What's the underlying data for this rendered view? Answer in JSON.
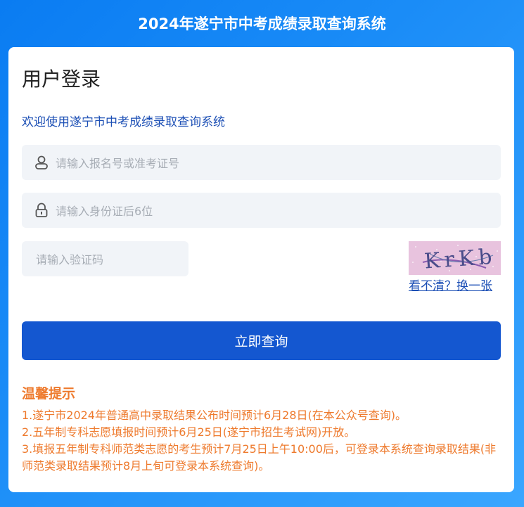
{
  "header": {
    "title": "2024年遂宁市中考成绩录取查询系统"
  },
  "login": {
    "title": "用户登录",
    "welcome": "欢迎使用遂宁市中考成绩录取查询系统",
    "username_placeholder": "请输入报名号或准考证号",
    "id_placeholder": "请输入身份证后6位",
    "captcha_placeholder": "请输入验证码",
    "captcha_text": "KrKb",
    "refresh_label": "看不清？换一张",
    "submit_label": "立即查询"
  },
  "tips": {
    "title": "温馨提示",
    "items": [
      "1.遂宁市2024年普通高中录取结果公布时间预计6月28日(在本公众号查询)。",
      "2.五年制专科志愿填报时间预计6月25日(遂宁市招生考试网)开放。",
      "3.填报五年制专科师范类志愿的考生预计7月25日上午10:00后，可登录本系统查询录取结果(非师范类录取结果预计8月上旬可登录本系统查询)。"
    ]
  },
  "colors": {
    "accent": "#1457d0",
    "tips": "#ee7a2d",
    "header_bg": "#0a7cf2"
  },
  "icons": [
    "user-icon",
    "lock-icon"
  ]
}
